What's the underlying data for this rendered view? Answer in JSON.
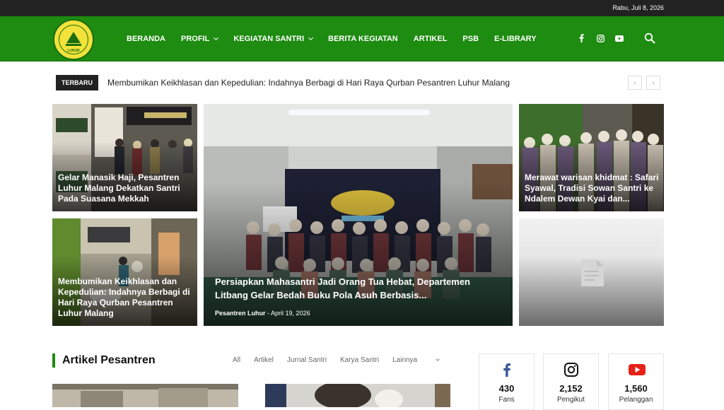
{
  "topbar": {
    "date": "Rabu, Juli 8, 2026"
  },
  "header": {
    "logo_text": "LUHUR",
    "nav": [
      {
        "label": "BERANDA",
        "dropdown": false
      },
      {
        "label": "PROFIL",
        "dropdown": true
      },
      {
        "label": "KEGIATAN SANTRI",
        "dropdown": true
      },
      {
        "label": "BERITA KEGIATAN",
        "dropdown": false
      },
      {
        "label": "ARTIKEL",
        "dropdown": false
      },
      {
        "label": "PSB",
        "dropdown": false
      },
      {
        "label": "E-LIBRARY",
        "dropdown": false
      }
    ],
    "socials": [
      "facebook-icon",
      "instagram-icon",
      "youtube-icon"
    ]
  },
  "ticker": {
    "badge": "TERBARU",
    "headline": "Membumikan Keikhlasan dan Kepedulian: Indahnya Berbagi di Hari Raya Qurban Pesantren Luhur Malang"
  },
  "featured": {
    "left_top": "Gelar Manasik Haji, Pesantren Luhur Malang Dekatkan Santri Pada Suasana Mekkah",
    "left_bottom": "Membumikan Keikhlasan dan Kepedulian: Indahnya Berbagi di Hari Raya Qurban Pesantren Luhur Malang",
    "center": "Persiapkan Mahasantri Jadi Orang Tua Hebat, Departemen Litbang Gelar Bedah Buku Pola Asuh Berbasis...",
    "center_author": "Pesantren Luhur",
    "center_date": "April 19, 2026",
    "right_top": "Merawat warisan khidmat : Safari Syawal, Tradisi Sowan Santri ke Ndalem Dewan Kyai dan..."
  },
  "section": {
    "title": "Artikel Pesantren",
    "filters": [
      "All",
      "Artikel",
      "Jurnal Santri",
      "Karya Santri",
      "Lainnya"
    ]
  },
  "social_counts": [
    {
      "icon": "facebook-icon",
      "count": "430",
      "label": "Fans"
    },
    {
      "icon": "instagram-icon",
      "count": "2,152",
      "label": "Pengikut"
    },
    {
      "icon": "youtube-icon",
      "count": "1,560",
      "label": "Pelanggan"
    }
  ],
  "colors": {
    "header_green": "#1e8b11",
    "topbar": "#222222",
    "accent": "#1e8b11"
  }
}
